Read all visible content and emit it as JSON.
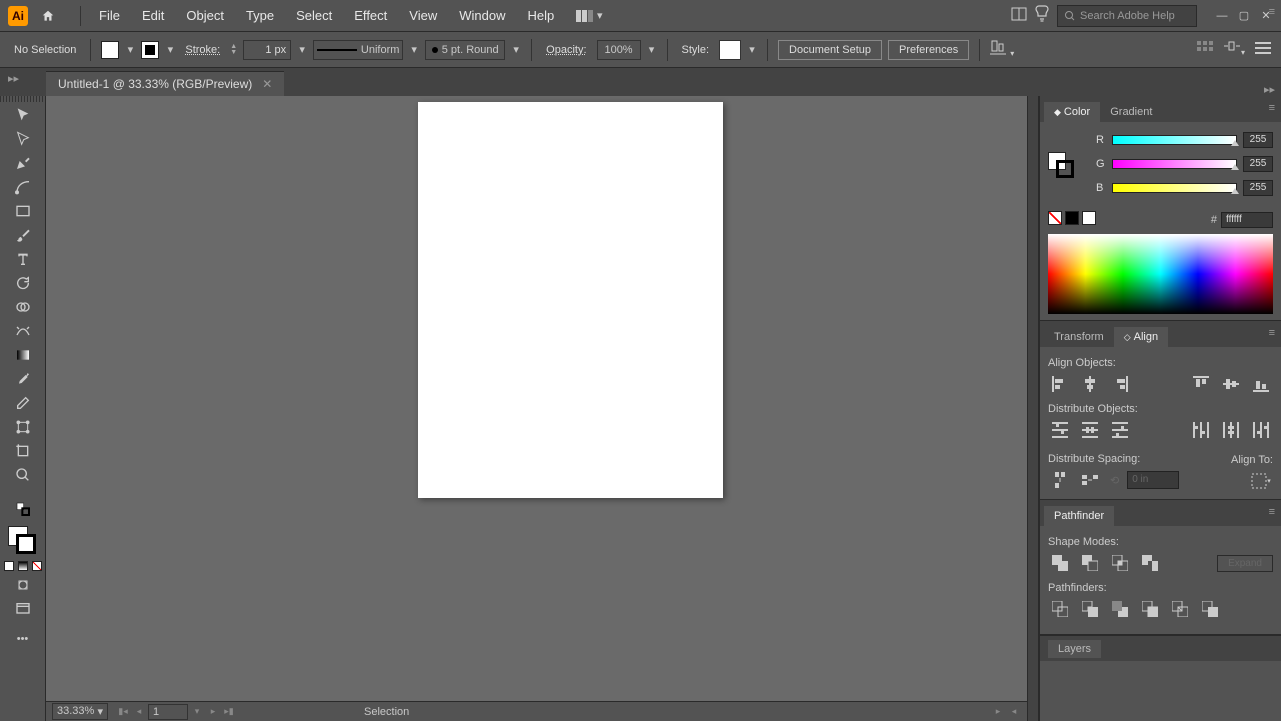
{
  "menu": {
    "items": [
      "File",
      "Edit",
      "Object",
      "Type",
      "Select",
      "Effect",
      "View",
      "Window",
      "Help"
    ]
  },
  "search_placeholder": "Search Adobe Help",
  "control": {
    "selection": "No Selection",
    "stroke_label": "Stroke:",
    "stroke_weight": "1 px",
    "profile": "Uniform",
    "brush": "5 pt. Round",
    "opacity_label": "Opacity:",
    "opacity_value": "100%",
    "style_label": "Style:",
    "doc_setup": "Document Setup",
    "prefs": "Preferences"
  },
  "tab": {
    "title": "Untitled-1 @ 33.33% (RGB/Preview)"
  },
  "status": {
    "zoom": "33.33%",
    "page": "1",
    "tool": "Selection"
  },
  "panels": {
    "color": {
      "tab_color": "Color",
      "tab_gradient": "Gradient",
      "r": "R",
      "g": "G",
      "b": "B",
      "r_val": "255",
      "g_val": "255",
      "b_val": "255",
      "hex_label": "#",
      "hex_val": "ffffff"
    },
    "align": {
      "tab_transform": "Transform",
      "tab_align": "Align",
      "align_objects": "Align Objects:",
      "distribute_objects": "Distribute Objects:",
      "distribute_spacing": "Distribute Spacing:",
      "align_to": "Align To:",
      "spacing_val": "0 in"
    },
    "pathfinder": {
      "tab": "Pathfinder",
      "shape_modes": "Shape Modes:",
      "pathfinders": "Pathfinders:",
      "expand": "Expand"
    },
    "layers": {
      "tab": "Layers"
    }
  }
}
